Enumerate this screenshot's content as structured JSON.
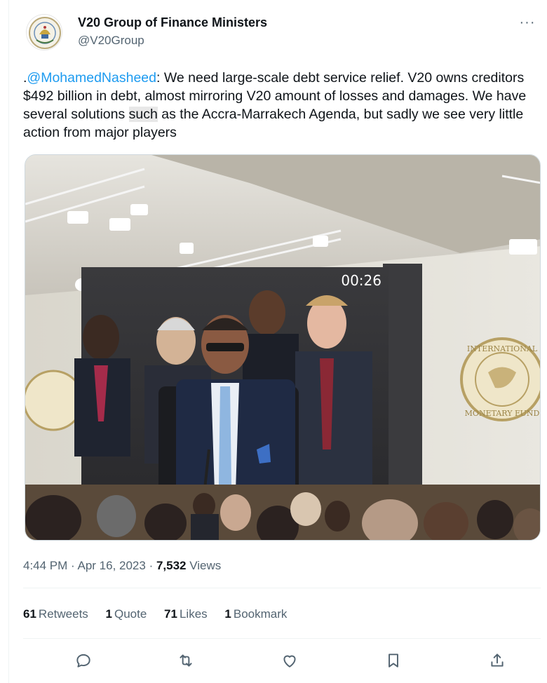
{
  "author": {
    "display_name": "V20 Group of Finance Ministers",
    "handle": "@V20Group",
    "avatar_icon": "v20-emblem-icon"
  },
  "more_label": "···",
  "tweet": {
    "prefix": ".",
    "mention": "@MohamedNasheed",
    "text_part1": ": We need large-scale debt service relief. V20 owns creditors $492 billion in debt, almost mirroring V20 amount of losses and damages. We have several solutions ",
    "highlight": "such",
    "text_part2": " as the Accra-Marrakech Agenda, but sadly we see very little action from major players"
  },
  "photo": {
    "screen_timer": "00:26"
  },
  "meta": {
    "time": "4:44 PM",
    "separator": " · ",
    "date": "Apr 16, 2023",
    "views_count": "7,532",
    "views_label": " Views"
  },
  "stats": [
    {
      "count": "61",
      "label": "Retweets"
    },
    {
      "count": "1",
      "label": "Quote"
    },
    {
      "count": "71",
      "label": "Likes"
    },
    {
      "count": "1",
      "label": "Bookmark"
    }
  ],
  "actions": {
    "reply_icon": "reply-icon",
    "retweet_icon": "retweet-icon",
    "like_icon": "heart-icon",
    "bookmark_icon": "bookmark-icon",
    "share_icon": "share-icon"
  },
  "colors": {
    "accent": "#1d9bf0",
    "secondary_text": "#536471",
    "primary_text": "#0f1419"
  }
}
